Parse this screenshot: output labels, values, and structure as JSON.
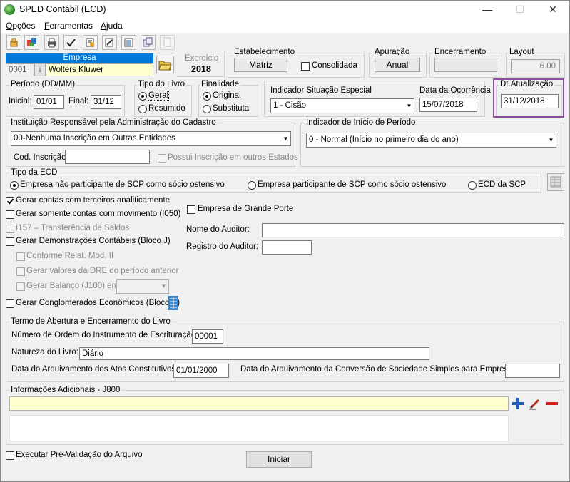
{
  "window": {
    "title": "SPED Contábil (ECD)",
    "minimize": "—",
    "maximize": "☐",
    "close": "✕"
  },
  "menu": [
    {
      "label": "Opções",
      "u": "O",
      "rest": "pções"
    },
    {
      "label": "Ferramentas",
      "u": "F",
      "rest": "erramentas"
    },
    {
      "label": "Ajuda",
      "u": "A",
      "rest": "juda"
    }
  ],
  "empresa": {
    "header": "Empresa",
    "code": "0001",
    "name": "Wolters Kluwer"
  },
  "exercicio": {
    "label": "Exercício",
    "value": "2018"
  },
  "estabelecimento": {
    "label": "Estabelecimento",
    "value": "Matriz",
    "consolidada": "Consolidada"
  },
  "apuracao": {
    "label": "Apuração",
    "value": "Anual"
  },
  "encerramento": {
    "label": "Encerramento",
    "value": ""
  },
  "layout": {
    "label": "Layout",
    "value": "6.00"
  },
  "periodo": {
    "label": "Período (DD/MM)",
    "inicial_label": "Inicial:",
    "inicial": "01/01",
    "final_label": "Final:",
    "final": "31/12"
  },
  "tipo_livro": {
    "label": "Tipo do Livro",
    "geral": "Geral",
    "resumido": "Resumido"
  },
  "finalidade": {
    "label": "Finalidade",
    "original": "Original",
    "substituta": "Substituta"
  },
  "indicador_situacao": {
    "label": "Indicador Situação Especial",
    "value": "1 - Cisão",
    "data_label": "Data da Ocorrência",
    "data": "15/07/2018"
  },
  "dt_atualizacao": {
    "label": "Dt.Atualização",
    "value": "31/12/2018"
  },
  "instituicao": {
    "label": "Instituição Responsável pela Administração do Cadastro",
    "value": "00-Nenhuma Inscrição em Outras Entidades",
    "cod_label": "Cod. Inscrição",
    "cod": "",
    "possui": "Possui Inscrição em outros Estados"
  },
  "indicador_inicio": {
    "label": "Indicador de Início de Período",
    "value": "0 - Normal (Início no primeiro dia do ano)"
  },
  "tipo_ecd": {
    "label": "Tipo da ECD",
    "opt1": "Empresa não participante de SCP como sócio ostensivo",
    "opt2": "Empresa participante de SCP como sócio ostensivo",
    "opt3": "ECD da SCP"
  },
  "options": {
    "gerar_terceiros": "Gerar contas com terceiros analiticamente",
    "gerar_movimento": "Gerar somente contas com movimento (I050)",
    "i157": "I157 – Transferência de Saldos",
    "gerar_demonstracoes": "Gerar Demonstrações Contábeis (Bloco J)",
    "conforme": "Conforme Relat. Mod. II",
    "gerar_dre": "Gerar valores da DRE do período anterior",
    "gerar_balanco": "Gerar Balanço (J100) em",
    "gerar_conglomerados": "Gerar Conglomerados Econômicos (Bloco K)",
    "grande_porte": "Empresa de Grande Porte",
    "nome_auditor": "Nome do Auditor:",
    "registro_auditor": "Registro do Auditor:"
  },
  "termo": {
    "label": "Termo de Abertura e Encerramento do Livro",
    "numero_label": "Número de Ordem do Instrumento de Escrituração:",
    "numero": "00001",
    "natureza_label": "Natureza do Livro:",
    "natureza": "Diário",
    "arquivamento_label": "Data do Arquivamento dos Atos Constitutivos:",
    "arquivamento": "01/01/2000",
    "conversao_label": "Data do Arquivamento da Conversão de Sociedade Simples para Empresária:",
    "conversao": ""
  },
  "info": {
    "label": "Informações Adicionais - J800"
  },
  "footer": {
    "pre_validacao": "Executar Pré-Validação do Arquivo",
    "iniciar": "Iniciar"
  },
  "colors": {
    "empresa_header": "#0078d7",
    "highlight": "#8e4ba0",
    "yellow_field": "#ffffd0"
  }
}
